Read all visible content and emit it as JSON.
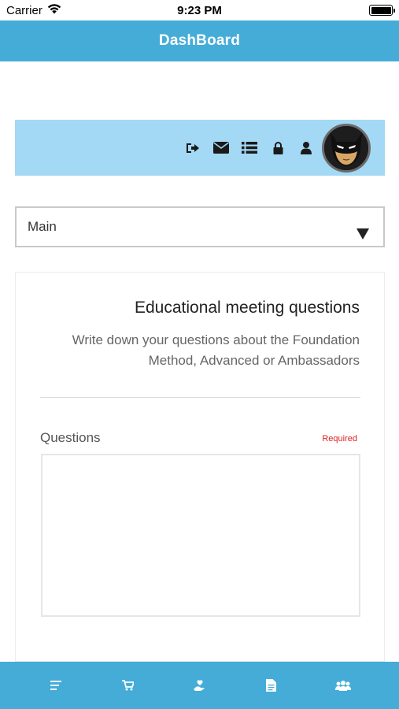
{
  "status_bar": {
    "carrier": "Carrier",
    "time": "9:23 PM",
    "battery_level": 1.0
  },
  "nav": {
    "title": "DashBoard"
  },
  "profile_strip": {
    "background": "#a3d9f5",
    "icons": [
      "logout-icon",
      "mail-icon",
      "list-icon",
      "lock-icon",
      "user-icon"
    ],
    "avatar": "batman-avatar"
  },
  "dropdown": {
    "selected": "Main"
  },
  "card": {
    "title": "Educational meeting questions",
    "description": "Write down your questions about the Foundation Method, Advanced or Ambassadors",
    "field": {
      "label": "Questions",
      "required_label": "Required",
      "value": ""
    }
  },
  "tab_bar": {
    "background": "#45acd8",
    "items": [
      "menu-icon",
      "cart-icon",
      "hand-heart-icon",
      "document-icon",
      "group-icon"
    ]
  },
  "colors": {
    "accent": "#45acd8",
    "required": "#e02020"
  }
}
